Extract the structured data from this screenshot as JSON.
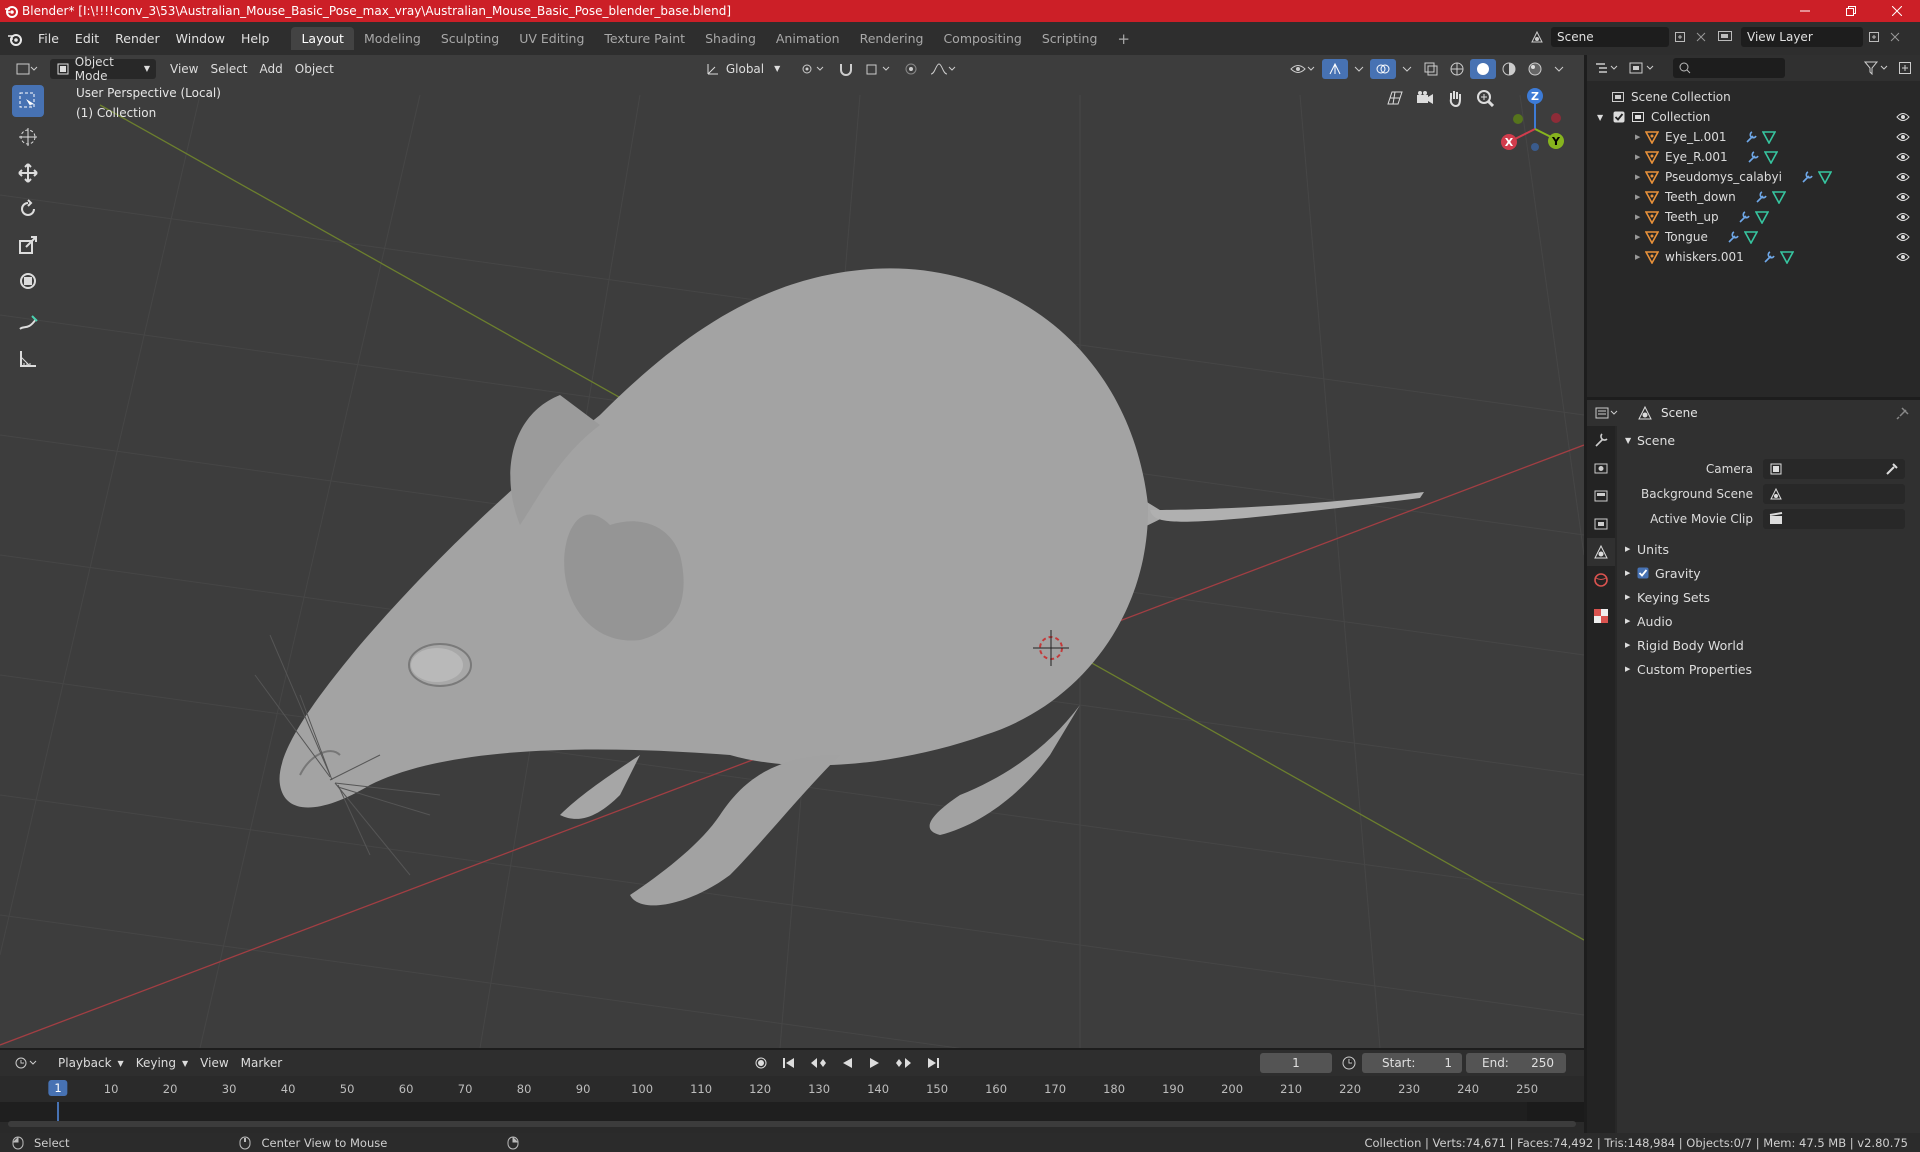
{
  "title_bar": {
    "text": "Blender* [I:\\!!!!conv_3\\53\\Australian_Mouse_Basic_Pose_max_vray\\Australian_Mouse_Basic_Pose_blender_base.blend]"
  },
  "menu": [
    "File",
    "Edit",
    "Render",
    "Window",
    "Help"
  ],
  "workspace_tabs": [
    "Layout",
    "Modeling",
    "Sculpting",
    "UV Editing",
    "Texture Paint",
    "Shading",
    "Animation",
    "Rendering",
    "Compositing",
    "Scripting"
  ],
  "active_workspace": "Layout",
  "scene_selector": {
    "scene": "Scene",
    "view_layer": "View Layer"
  },
  "viewport_header": {
    "mode": "Object Mode",
    "menus": [
      "View",
      "Select",
      "Add",
      "Object"
    ],
    "transform_orientation": "Global"
  },
  "viewport_info": {
    "line1": "User Perspective (Local)",
    "line2": "(1) Collection"
  },
  "gizmo_axes": {
    "z": "Z",
    "x": "X",
    "y": "Y"
  },
  "outliner": {
    "root": "Scene Collection",
    "collection": "Collection",
    "objects": [
      "Eye_L.001",
      "Eye_R.001",
      "Pseudomys_calabyi",
      "Teeth_down",
      "Teeth_up",
      "Tongue",
      "whiskers.001"
    ]
  },
  "properties": {
    "header": "Scene",
    "section": "Scene",
    "fields": [
      {
        "label": "Camera",
        "value": ""
      },
      {
        "label": "Background Scene",
        "value": ""
      },
      {
        "label": "Active Movie Clip",
        "value": ""
      }
    ],
    "panels": [
      "Units",
      "Gravity",
      "Keying Sets",
      "Audio",
      "Rigid Body World",
      "Custom Properties"
    ],
    "gravity_enabled": true
  },
  "timeline": {
    "menus": [
      "Playback",
      "Keying",
      "View",
      "Marker"
    ],
    "current_frame": "1",
    "start_label": "Start:",
    "start": "1",
    "end_label": "End:",
    "end": "250",
    "ruler": [
      "1",
      "10",
      "20",
      "30",
      "40",
      "50",
      "60",
      "70",
      "80",
      "90",
      "100",
      "110",
      "120",
      "130",
      "140",
      "150",
      "160",
      "170",
      "180",
      "190",
      "200",
      "210",
      "220",
      "230",
      "240",
      "250"
    ]
  },
  "statusbar": {
    "select": "Select",
    "center": "Center View to Mouse",
    "stats": "Collection | Verts:74,671 | Faces:74,492 | Tris:148,984 | Objects:0/7 | Mem: 47.5 MB | v2.80.75"
  },
  "colors": {
    "accent": "#4772b3",
    "title_bar": "#cc1f27",
    "object_icon": "#e8913a",
    "modifier_icon": "#6fa8e8",
    "mesh_icon": "#37c5a0"
  }
}
